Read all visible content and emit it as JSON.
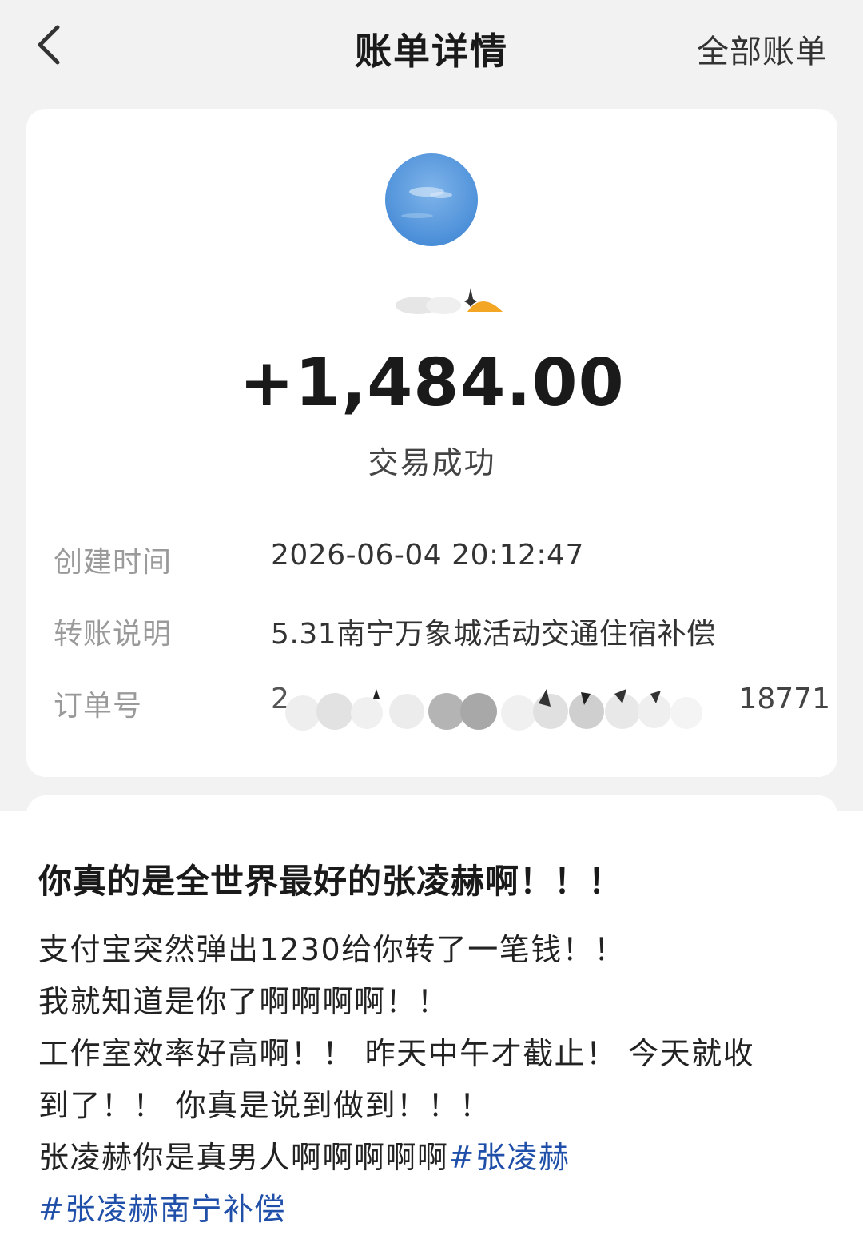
{
  "header": {
    "title": "账单详情",
    "all_bills": "全部账单",
    "back_icon": "chevron-left-icon"
  },
  "card": {
    "amount": "+1,484.00",
    "status": "交易成功",
    "rows": [
      {
        "label": "创建时间",
        "value": "2026-06-04 20:12:47"
      },
      {
        "label": "转账说明",
        "value": "5.31南宁万象城活动交通住宿补偿"
      },
      {
        "label": "订单号",
        "value_start": "2",
        "value_end": "18771"
      }
    ]
  },
  "post": {
    "title": "你真的是全世界最好的张凌赫啊！！！",
    "lines": [
      "支付宝突然弹出1230给你转了一笔钱！！",
      "我就知道是你了啊啊啊啊！！",
      "工作室效率好高啊！！ 昨天中午才截止！ 今天就收",
      "到了！！ 你真是说到做到！！！"
    ],
    "last_line_text": "张凌赫你是真男人啊啊啊啊啊",
    "hashtag_1": "#张凌赫",
    "hashtag_2": "#张凌赫南宁补偿"
  },
  "colors": {
    "background": "#f2f2f2",
    "card": "#ffffff",
    "hashtag": "#1f4fa8"
  }
}
